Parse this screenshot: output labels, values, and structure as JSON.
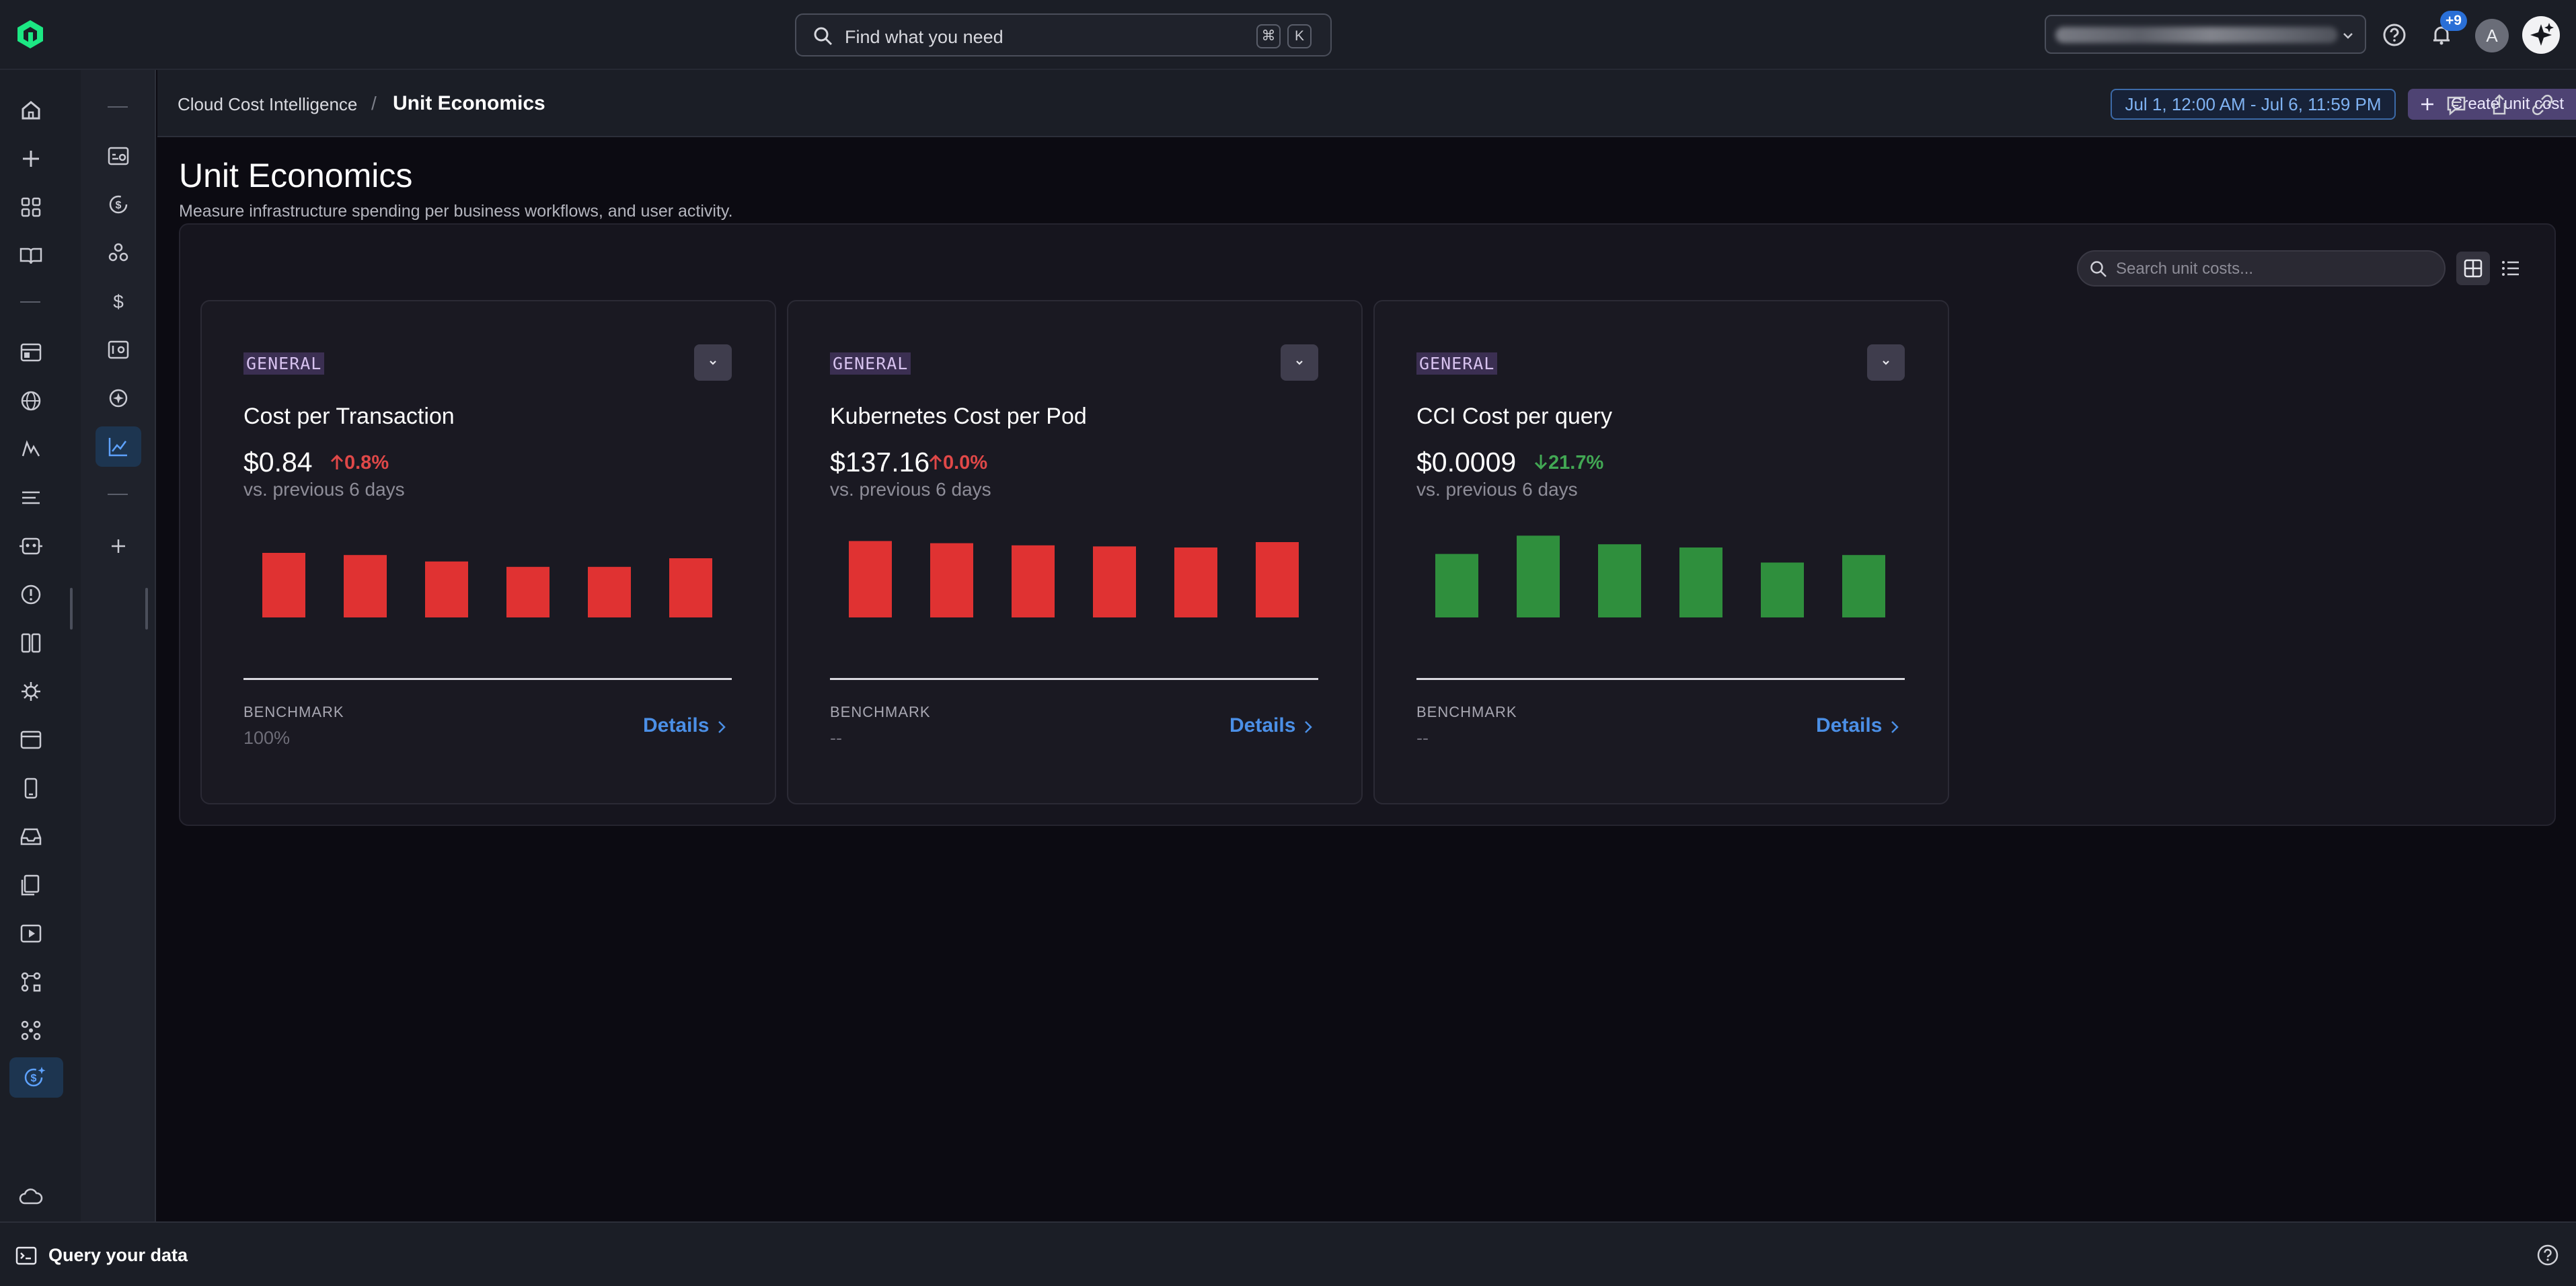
{
  "search": {
    "placeholder": "Find what you need",
    "shortcut": [
      "⌘",
      "K"
    ]
  },
  "notifications_badge": "+9",
  "user_avatar": "A",
  "breadcrumb": {
    "parent": "Cloud Cost Intelligence",
    "current": "Unit Economics"
  },
  "date_range": "Jul 1, 12:00 AM - Jul 6, 11:59 PM",
  "create_button": "Create unit cost",
  "page": {
    "title": "Unit Economics",
    "subtitle": "Measure infrastructure spending per business workflows, and user activity."
  },
  "unit_search": {
    "placeholder": "Search unit costs..."
  },
  "colors": {
    "up": "#e04848",
    "down": "#42a854",
    "bar_red": "#e03232",
    "bar_green": "#2f8f3d",
    "accent": "#4b8fe6"
  },
  "cards": [
    {
      "tag": "GENERAL",
      "title": "Cost per Transaction",
      "value": "$0.84",
      "delta": "0.8%",
      "direction": "up",
      "compare": "vs. previous 6 days",
      "bars": [
        0.6,
        0.58,
        0.52,
        0.47,
        0.47,
        0.55
      ],
      "bar_color": "red",
      "benchmark_label": "BENCHMARK",
      "benchmark_value": "100%",
      "details": "Details"
    },
    {
      "tag": "GENERAL",
      "title": "Kubernetes Cost per Pod",
      "value": "$137.16",
      "delta": "0.0%",
      "direction": "up",
      "compare": "vs. previous 6 days",
      "bars": [
        0.71,
        0.69,
        0.67,
        0.66,
        0.65,
        0.7
      ],
      "bar_color": "red",
      "benchmark_label": "BENCHMARK",
      "benchmark_value": "--",
      "details": "Details"
    },
    {
      "tag": "GENERAL",
      "title": "CCI Cost per query",
      "value": "$0.0009",
      "delta": "21.7%",
      "direction": "down",
      "compare": "vs. previous 6 days",
      "bars": [
        0.59,
        0.76,
        0.68,
        0.65,
        0.51,
        0.58
      ],
      "bar_color": "green",
      "benchmark_label": "BENCHMARK",
      "benchmark_value": "--",
      "details": "Details"
    }
  ],
  "bottom": {
    "query_label": "Query your data"
  }
}
